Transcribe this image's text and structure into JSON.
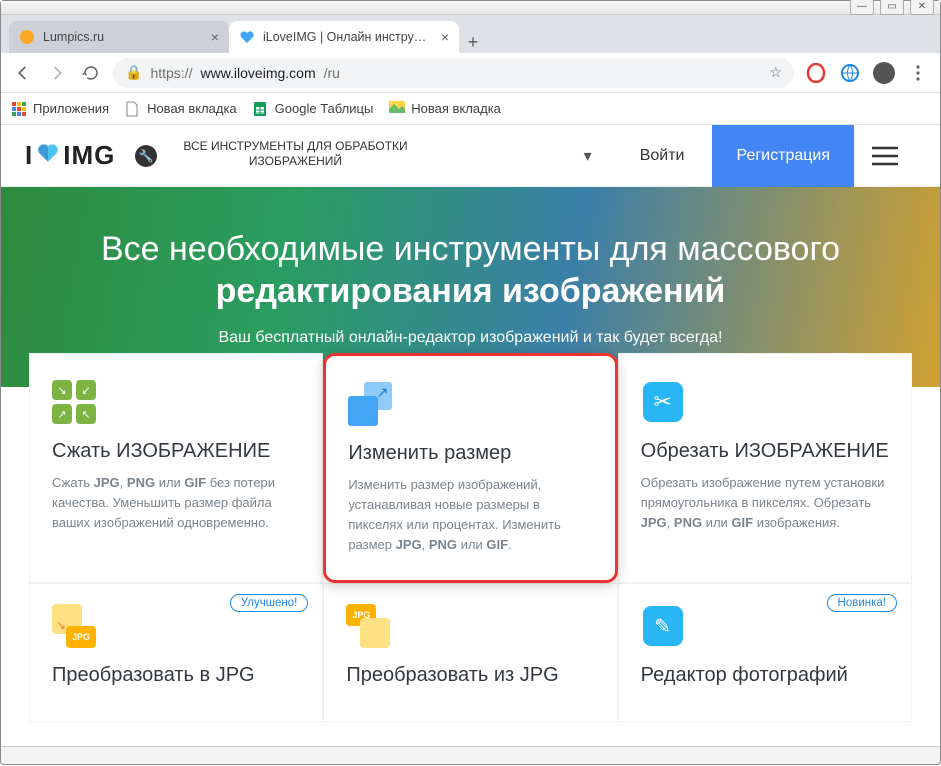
{
  "window": {
    "tabs": [
      {
        "title": "Lumpics.ru",
        "active": false
      },
      {
        "title": "iLoveIMG | Онлайн инструменты",
        "active": true
      }
    ],
    "url_display": "https://www.iloveimg.com/ru",
    "url_domain": "www.iloveimg.com",
    "url_path": "/ru"
  },
  "bookmarks": [
    {
      "label": "Приложения"
    },
    {
      "label": "Новая вкладка"
    },
    {
      "label": "Google Таблицы"
    },
    {
      "label": "Новая вкладка"
    }
  ],
  "header": {
    "logo_prefix": "I",
    "logo_suffix": "IMG",
    "mid_line1": "ВСЕ ИНСТРУМЕНТЫ ДЛЯ ОБРАБОТКИ",
    "mid_line2": "ИЗОБРАЖЕНИЙ",
    "login": "Войти",
    "register": "Регистрация"
  },
  "hero": {
    "title_1": "Все необходимые инструменты для массового ",
    "title_bold": "редактирования изображений",
    "sub": "Ваш бесплатный онлайн-редактор изображений и так будет всегда!"
  },
  "tools": [
    {
      "title": "Сжать ИЗОБРАЖЕНИЕ",
      "desc_html": "Сжать <b>JPG</b>, <b>PNG</b> или <b>GIF</b> без потери качества. Уменьшить размер файла ваших изображений одновременно."
    },
    {
      "title": "Изменить размер",
      "desc_html": "Изменить размер изображений, устанавливая новые размеры в пикселях или процентах. Изменить размер <b>JPG</b>, <b>PNG</b> или <b>GIF</b>."
    },
    {
      "title": "Обрезать ИЗОБРАЖЕНИЕ",
      "desc_html": "Обрезать изображение путем установки прямоугольника в пикселях. Обрезать <b>JPG</b>, <b>PNG</b> или <b>GIF</b> изображения."
    },
    {
      "title": "Преобразовать в JPG",
      "badge": "Улучшено!",
      "desc_html": ""
    },
    {
      "title": "Преобразовать из JPG",
      "desc_html": ""
    },
    {
      "title": "Редактор фотографий",
      "badge": "Новинка!",
      "desc_html": ""
    }
  ]
}
